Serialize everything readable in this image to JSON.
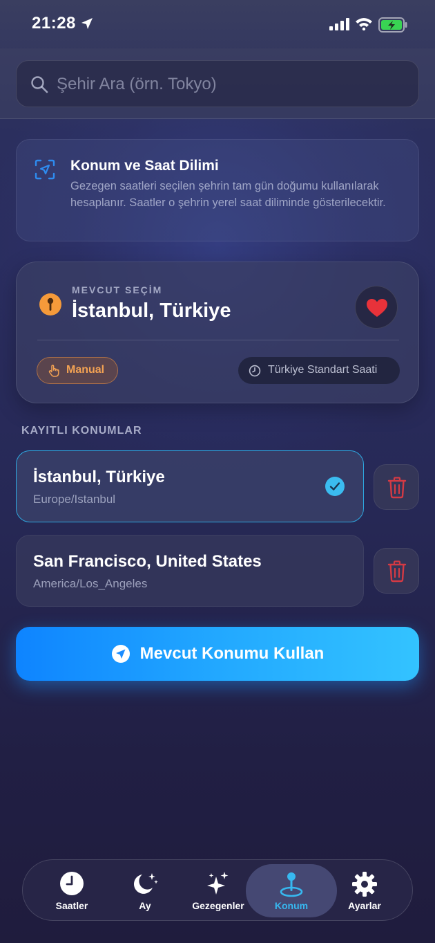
{
  "status_bar": {
    "time": "21:28"
  },
  "search": {
    "placeholder": "Şehir Ara (örn. Tokyo)"
  },
  "info_card": {
    "title": "Konum ve Saat Dilimi",
    "body": "Gezegen saatleri seçilen şehrin tam gün doğumu kullanılarak hesaplanır. Saatler o şehrin yerel saat diliminde gösterilecektir."
  },
  "current_selection": {
    "label": "MEVCUT SEÇİM",
    "city": "İstanbul, Türkiye",
    "mode_badge": "Manual",
    "timezone_badge": "Türkiye Standart Saati"
  },
  "saved_locations": {
    "title": "KAYITLI KONUMLAR",
    "items": [
      {
        "name": "İstanbul, Türkiye",
        "timezone": "Europe/Istanbul",
        "selected": true
      },
      {
        "name": "San Francisco, United States",
        "timezone": "America/Los_Angeles",
        "selected": false
      }
    ]
  },
  "use_location_button": {
    "label": "Mevcut Konumu Kullan"
  },
  "tab_bar": {
    "tabs": [
      {
        "label": "Saatler",
        "icon": "clock-icon"
      },
      {
        "label": "Ay",
        "icon": "moon-stars-icon"
      },
      {
        "label": "Gezegenler",
        "icon": "sparkles-icon"
      },
      {
        "label": "Konum",
        "icon": "location-pin-icon",
        "active": true
      },
      {
        "label": "Ayarlar",
        "icon": "gear-icon"
      }
    ]
  },
  "colors": {
    "accent": "#2ea8e0",
    "cta_start": "#0e84ff",
    "cta_end": "#33c3ff",
    "pin_orange": "#f59a3a",
    "favorite_red": "#e8323a",
    "delete_red": "#d43a44"
  }
}
